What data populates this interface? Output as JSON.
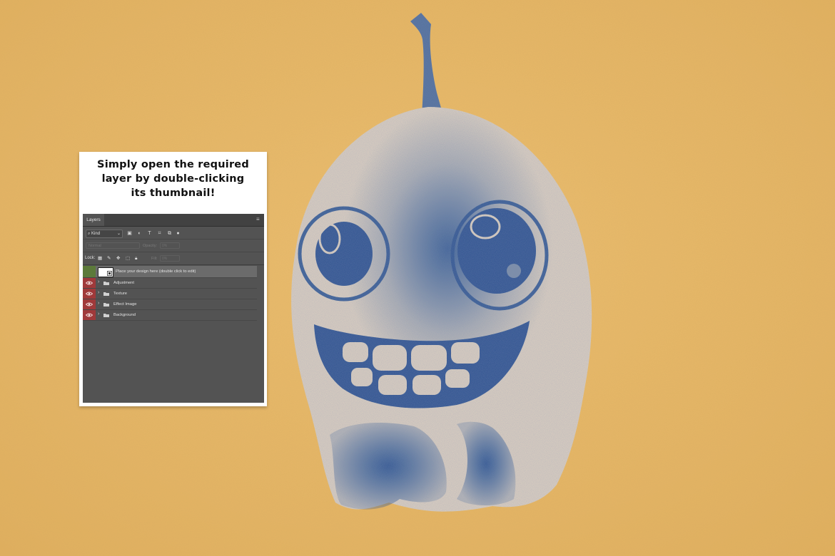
{
  "card": {
    "title_line1": "Simply open the required",
    "title_line2": "layer by double-clicking",
    "title_line3": "its thumbnail!"
  },
  "layers_panel": {
    "tab_label": "Layers",
    "filter_kind": "Kind",
    "blend_mode": "Normal",
    "opacity_label": "Opacity:",
    "opacity_value": "0%",
    "lock_label": "Lock:",
    "fill_label": "Fill:",
    "fill_value": "0%",
    "layers": [
      {
        "name": "Place your design here (double click to edit)",
        "type": "smart-object",
        "visible": true
      },
      {
        "name": "Adjustment",
        "type": "group",
        "visible": true
      },
      {
        "name": "Texture",
        "type": "group",
        "visible": true
      },
      {
        "name": "Effect Image",
        "type": "group",
        "visible": true
      },
      {
        "name": "Background",
        "type": "group",
        "visible": true
      }
    ]
  },
  "colors": {
    "background": "#e9b868",
    "ink_blue": "#1f4a8c",
    "sand": "#e6d7c2",
    "visibility_red": "#a0393a",
    "selected_green": "#5c7a3a"
  },
  "icons": [
    "search-icon",
    "chevron-down-icon",
    "image-filter-icon",
    "adjustment-filter-icon",
    "type-filter-icon",
    "shape-filter-icon",
    "smart-object-filter-icon",
    "filter-toggle-icon",
    "panel-menu-icon",
    "lock-pixels-icon",
    "lock-paint-icon",
    "lock-move-icon",
    "lock-artboard-icon",
    "lock-all-icon",
    "eye-icon",
    "folder-icon",
    "chevron-right-icon"
  ]
}
